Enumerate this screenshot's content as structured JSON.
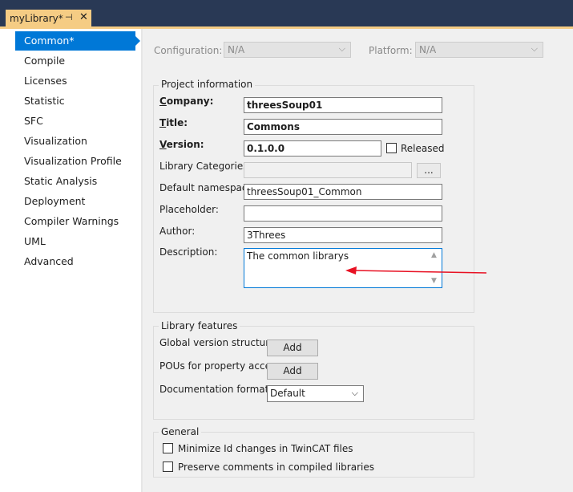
{
  "document_tab": {
    "title": "myLibrary*",
    "pin_icon": "pin-icon",
    "close_glyph": "✕"
  },
  "nav": {
    "items": [
      {
        "label": "Common*",
        "active": true
      },
      {
        "label": "Compile"
      },
      {
        "label": "Licenses"
      },
      {
        "label": "Statistic"
      },
      {
        "label": "SFC"
      },
      {
        "label": "Visualization"
      },
      {
        "label": "Visualization Profile"
      },
      {
        "label": "Static Analysis"
      },
      {
        "label": "Deployment"
      },
      {
        "label": "Compiler Warnings"
      },
      {
        "label": "UML"
      },
      {
        "label": "Advanced"
      }
    ]
  },
  "top_bar": {
    "configuration_label": "Configuration:",
    "configuration_value": "N/A",
    "platform_label": "Platform:",
    "platform_value": "N/A"
  },
  "project_info": {
    "title": "Project information",
    "company_label": "Company:",
    "company_value": "threesSoup01",
    "title_label": "Title:",
    "title_value": "Commons",
    "version_label": "Version:",
    "version_value": "0.1.0.0",
    "released_label": "Released",
    "library_categories_label": "Library Categories:",
    "library_categories_value": "",
    "browse_label": "...",
    "default_namespace_label": "Default namespace:",
    "default_namespace_value": "threesSoup01_Common",
    "placeholder_label": "Placeholder:",
    "placeholder_value": "",
    "author_label": "Author:",
    "author_value": "3Threes",
    "description_label": "Description:",
    "description_value": "The common librarys"
  },
  "library_features": {
    "title": "Library features",
    "global_version_label": "Global version structure:",
    "global_version_button": "Add",
    "pous_label": "POUs for property access:",
    "pous_button": "Add",
    "doc_format_label": "Documentation format:",
    "doc_format_value": "Default"
  },
  "general": {
    "title": "General",
    "minimize_label": "Minimize Id changes in TwinCAT files",
    "preserve_label": "Preserve comments in compiled libraries"
  },
  "annotation": {
    "arrow_color": "#e81123"
  },
  "colors": {
    "accent": "#0078d7",
    "tab_bg": "#f5cc84",
    "title_bar": "#293955"
  }
}
